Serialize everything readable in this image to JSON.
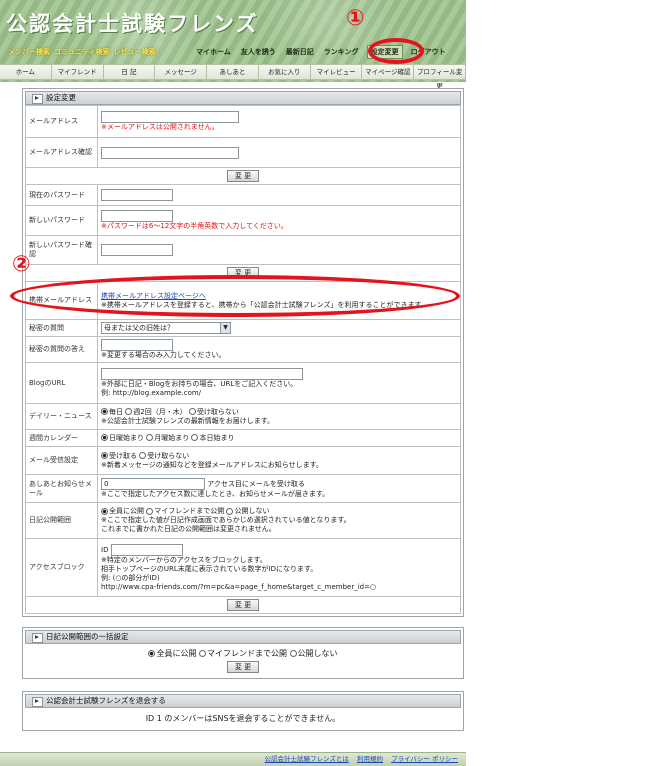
{
  "site_title": "公認会計士試験フレンズ",
  "nav_search": [
    "メンバー検索",
    "コミュニティ検索",
    "レビュー検索"
  ],
  "nav_top": [
    "マイホーム",
    "友人を誘う",
    "最新日記",
    "ランキング",
    "設定変更",
    "ログアウト"
  ],
  "nav_main": [
    "ホーム",
    "マイフレンド",
    "日 記",
    "メッセージ",
    "あしあと",
    "お気に入り",
    "マイレビュー",
    "マイページ確認",
    "プロフィール変更"
  ],
  "annotations": {
    "mark1": "①",
    "mark2": "②"
  },
  "settings": {
    "title": "設定変更",
    "email_label": "メールアドレス",
    "email_note": "※メールアドレスは公開されません。",
    "email_confirm_label": "メールアドレス確認",
    "change_button": "変 更",
    "current_pw_label": "現在のパスワード",
    "new_pw_label": "新しいパスワード",
    "new_pw_note": "※パスワードは6〜12文字の半角英数で入力してください。",
    "new_pw_confirm_label": "新しいパスワード確認",
    "mobile_label": "携帯メールアドレス",
    "mobile_link": "携帯メールアドレス設定ページへ",
    "mobile_note": "※携帯メールアドレスを登録すると、携帯から「公認会計士試験フレンズ」を利用することができます。",
    "secret_q_label": "秘密の質問",
    "secret_q_value": "母または父の旧姓は？",
    "secret_a_label": "秘密の質問の答え",
    "secret_a_note": "※変更する場合のみ入力してください。",
    "blog_label": "BlogのURL",
    "blog_note1": "※外部に日記・Blogをお持ちの場合、URLをご記入ください。",
    "blog_note2": "例: http://blog.example.com/",
    "news_label": "デイリー・ニュース",
    "news_options": [
      "毎日",
      "週2回（月・木）",
      "受け取らない"
    ],
    "news_note": "※公認会計士試験フレンズの最新情報をお届けします。",
    "calendar_label": "週間カレンダー",
    "calendar_options": [
      "日曜始まり",
      "月曜始まり",
      "本日始まり"
    ],
    "mail_label": "メール受信設定",
    "mail_options": [
      "受け取る",
      "受け取らない"
    ],
    "mail_note": "※新着メッセージの通知などを登録メールアドレスにお知らせします。",
    "ashiato_label": "あしあとお知らせメール",
    "ashiato_value": "0",
    "ashiato_suffix": "アクセス目にメールを受け取る",
    "ashiato_note": "※ここで指定したアクセス数に達したとき、お知らせメールが届きます。",
    "diary_label": "日記公開範囲",
    "diary_options": [
      "全員に公開",
      "マイフレンドまで公開",
      "公開しない"
    ],
    "diary_note1": "※ここで指定した値が日記作成画面であらかじめ選択されている値となります。",
    "diary_note2": "これまでに書かれた日記の公開範囲は変更されません。",
    "block_label": "アクセスブロック",
    "block_id_label": "ID",
    "block_note1": "※特定のメンバーからのアクセスをブロックします。",
    "block_note2": "相手トップページのURL末尾に表示されている数字がIDになります。",
    "block_note3": "例: (○の部分がID)",
    "block_note4": "http://www.cpa-friends.com/?m=pc&a=page_f_home&target_c_member_id=○"
  },
  "diary_bulk": {
    "title": "日記公開範囲の一括設定",
    "options": [
      "全員に公開",
      "マイフレンドまで公開",
      "公開しない"
    ],
    "button": "変 更"
  },
  "withdraw": {
    "title": "公認会計士試験フレンズを退会する",
    "note": "ID 1 のメンバーはSNSを退会することができません。"
  },
  "footer": [
    "公認会計士試験フレンズとは",
    "利用規約",
    "プライバシー ポリシー"
  ],
  "colors": {
    "accent_red": "#e3141b",
    "header_green": "#9cbf8c",
    "link": "#1b49b5"
  }
}
